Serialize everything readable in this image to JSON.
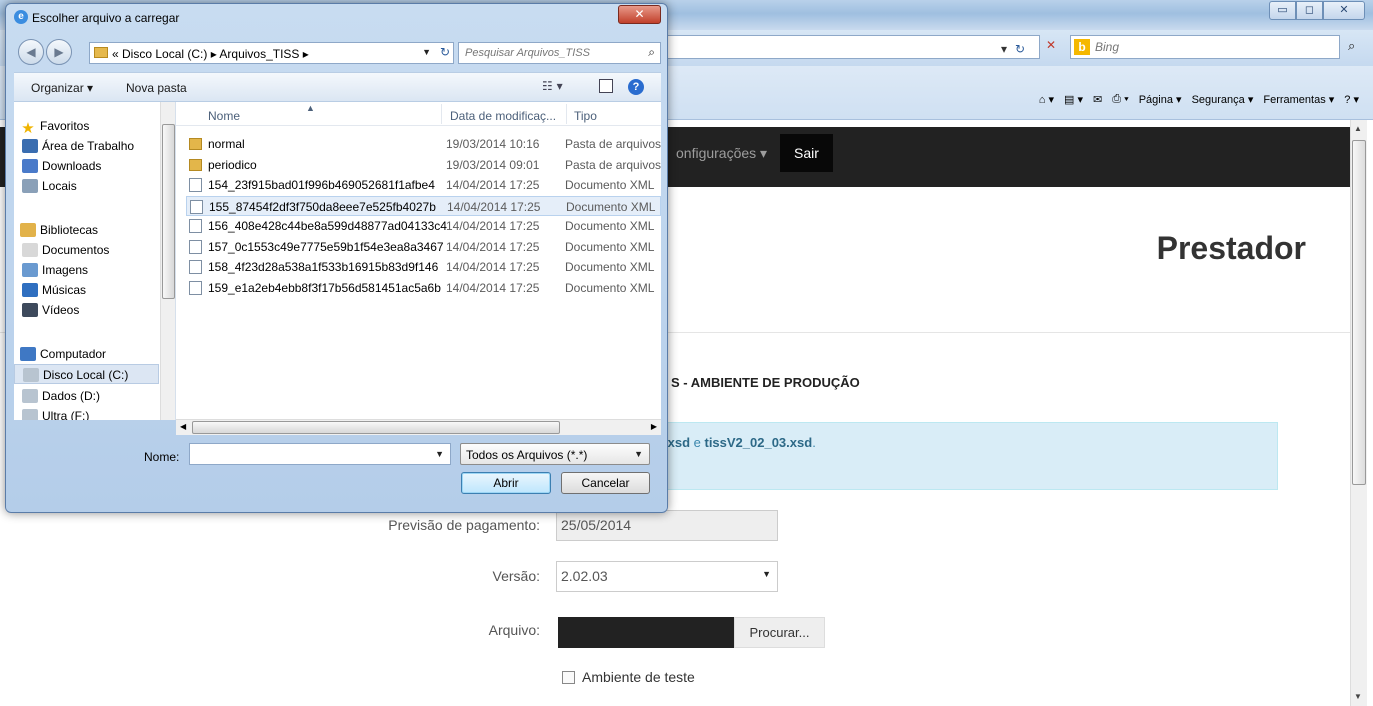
{
  "browser": {
    "search_placeholder": "Bing",
    "command_bar": {
      "pagina": "Página ▾",
      "seguranca": "Segurança ▾",
      "ferramentas": "Ferramentas ▾"
    }
  },
  "page": {
    "nav": {
      "configuracoes": "onfigurações ▾",
      "sair": "Sair"
    },
    "title": "Prestador",
    "section_heading": "S - AMBIENTE DE PRODUÇÃO",
    "info": {
      "part1": ".xsd",
      "part2": " e ",
      "part3": "tissV2_02_03.xsd",
      "part4": "."
    },
    "form": {
      "pagamento_label": "Previsão de pagamento:",
      "pagamento_value": "25/05/2014",
      "versao_label": "Versão:",
      "versao_value": "2.02.03",
      "arquivo_label": "Arquivo:",
      "procurar_label": "Procurar...",
      "teste_label": "Ambiente de teste"
    }
  },
  "dialog": {
    "title": "Escolher arquivo a carregar",
    "breadcrumb": "« Disco Local (C:) ▸ Arquivos_TISS ▸",
    "search_placeholder": "Pesquisar Arquivos_TISS",
    "toolbar": {
      "organizar": "Organizar ▾",
      "nova_pasta": "Nova pasta"
    },
    "nav": [
      {
        "label": "Favoritos",
        "icon": "star-icon"
      },
      {
        "label": "Área de Trabalho",
        "icon": "desktop-icon"
      },
      {
        "label": "Downloads",
        "icon": "downloads-icon"
      },
      {
        "label": "Locais",
        "icon": "recent-places-icon"
      },
      {
        "label": "Bibliotecas",
        "icon": "libraries-icon"
      },
      {
        "label": "Documentos",
        "icon": "documents-icon"
      },
      {
        "label": "Imagens",
        "icon": "pictures-icon"
      },
      {
        "label": "Músicas",
        "icon": "music-icon"
      },
      {
        "label": "Vídeos",
        "icon": "videos-icon"
      },
      {
        "label": "Computador",
        "icon": "computer-icon"
      },
      {
        "label": "Disco Local (C:)",
        "icon": "drive-icon"
      },
      {
        "label": "Dados (D:)",
        "icon": "drive-icon"
      },
      {
        "label": "Ultra (F:)",
        "icon": "drive-icon"
      }
    ],
    "columns": {
      "nome": "Nome",
      "data": "Data de modificaç...",
      "tipo": "Tipo"
    },
    "files": [
      {
        "name": "normal",
        "date": "19/03/2014 10:16",
        "type": "Pasta de arquivos",
        "kind": "folder"
      },
      {
        "name": "periodico",
        "date": "19/03/2014 09:01",
        "type": "Pasta de arquivos",
        "kind": "folder"
      },
      {
        "name": "154_23f915bad01f996b469052681f1afbe4",
        "date": "14/04/2014 17:25",
        "type": "Documento XML",
        "kind": "xml"
      },
      {
        "name": "155_87454f2df3f750da8eee7e525fb4027b",
        "date": "14/04/2014 17:25",
        "type": "Documento XML",
        "kind": "xml"
      },
      {
        "name": "156_408e428c44be8a599d48877ad04133c4",
        "date": "14/04/2014 17:25",
        "type": "Documento XML",
        "kind": "xml"
      },
      {
        "name": "157_0c1553c49e7775e59b1f54e3ea8a3467",
        "date": "14/04/2014 17:25",
        "type": "Documento XML",
        "kind": "xml"
      },
      {
        "name": "158_4f23d28a538a1f533b16915b83d9f146",
        "date": "14/04/2014 17:25",
        "type": "Documento XML",
        "kind": "xml"
      },
      {
        "name": "159_e1a2eb4ebb8f3f17b56d581451ac5a6b",
        "date": "14/04/2014 17:25",
        "type": "Documento XML",
        "kind": "xml"
      }
    ],
    "nome_label": "Nome:",
    "nome_value": "",
    "filter_value": "Todos os Arquivos (*.*)",
    "abrir_label": "Abrir",
    "cancelar_label": "Cancelar"
  }
}
